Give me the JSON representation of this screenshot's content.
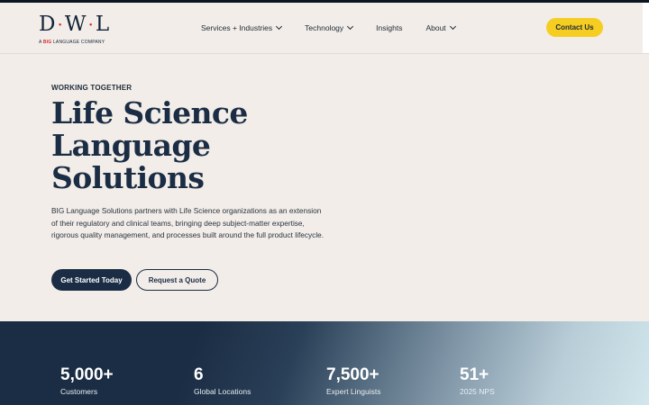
{
  "brand": {
    "logo_mark_left": "D",
    "logo_mark_mid": "W",
    "logo_mark_right": "L",
    "logo_sub_prefix": "A",
    "logo_sub_big": "BIG",
    "logo_sub_suffix": "LANGUAGE COMPANY",
    "accent_red": "#e0262b",
    "navy": "#1b2d44",
    "cta_yellow": "#f6cd21"
  },
  "nav": {
    "items": [
      {
        "label": "Services + Industries",
        "has_dropdown": true
      },
      {
        "label": "Technology",
        "has_dropdown": true
      },
      {
        "label": "Insights",
        "has_dropdown": false
      },
      {
        "label": "About",
        "has_dropdown": true
      }
    ],
    "contact_label": "Contact Us"
  },
  "hero": {
    "eyebrow": "WORKING TOGETHER",
    "title_line1": "Life Science",
    "title_line2": "Language",
    "title_line3": "Solutions",
    "description": "BIG Language Solutions partners with Life Science organizations as an extension of their regulatory and clinical teams, bringing deep subject-matter expertise, rigorous quality management, and processes built around the full product lifecycle.",
    "primary_cta": "Get Started Today",
    "secondary_cta": "Request a Quote"
  },
  "stats": [
    {
      "value": "5,000+",
      "label": "Customers"
    },
    {
      "value": "6",
      "label": "Global Locations"
    },
    {
      "value": "7,500+",
      "label": "Expert Linguists"
    },
    {
      "value": "51+",
      "label": "2025 NPS"
    }
  ]
}
